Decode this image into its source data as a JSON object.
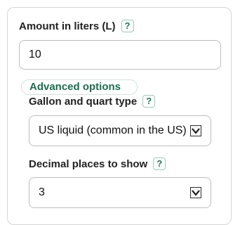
{
  "amount": {
    "label": "Amount in liters (L)",
    "help": "?",
    "value": "10"
  },
  "advanced": {
    "label": "Advanced options"
  },
  "gallon_type": {
    "label": "Gallon and quart type",
    "help": "?",
    "selected": "US liquid (common in the US)"
  },
  "decimals": {
    "label": "Decimal places to show",
    "help": "?",
    "selected": "3"
  },
  "icons": {
    "help": "question-mark",
    "dropdown": "chevron-down"
  },
  "colors": {
    "accent": "#1b7a55",
    "border": "#bdbdbd"
  }
}
